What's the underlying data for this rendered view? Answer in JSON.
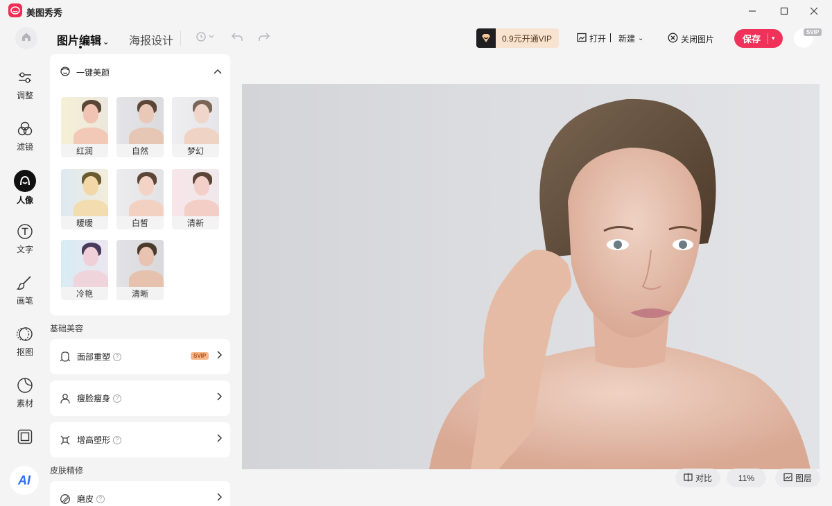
{
  "app": {
    "name": "美图秀秀",
    "brand_color": "#f02e55"
  },
  "header": {
    "tabs": [
      {
        "label": "图片编辑",
        "active": true
      },
      {
        "label": "海报设计",
        "active": false
      }
    ],
    "vip_label": "0.9元开通VIP",
    "open_label": "打开",
    "new_label": "新建",
    "close_label": "关闭图片",
    "save_label": "保存",
    "user_badge": "SVIP"
  },
  "sidebar": {
    "items": [
      {
        "label": "调整",
        "icon": "sliders-icon"
      },
      {
        "label": "滤镜",
        "icon": "filter-icon"
      },
      {
        "label": "人像",
        "icon": "portrait-icon",
        "active": true
      },
      {
        "label": "文字",
        "icon": "text-icon"
      },
      {
        "label": "画笔",
        "icon": "brush-icon"
      },
      {
        "label": "抠图",
        "icon": "cutout-icon"
      },
      {
        "label": "素材",
        "icon": "sticker-icon"
      },
      {
        "label": "",
        "icon": "frame-icon"
      }
    ],
    "ai_label": "AI"
  },
  "panel": {
    "one_click": {
      "title": "一键美颜",
      "presets": [
        "红润",
        "自然",
        "梦幻",
        "暖暖",
        "白皙",
        "清新",
        "冷艳",
        "清晰"
      ]
    },
    "basic": {
      "title": "基础美容",
      "items": [
        {
          "label": "面部重塑",
          "badge": "SVIP"
        },
        {
          "label": "瘦脸瘦身"
        },
        {
          "label": "增高塑形"
        }
      ]
    },
    "skin": {
      "title": "皮肤精修",
      "items": [
        {
          "label": "磨皮"
        }
      ]
    }
  },
  "bottom": {
    "compare_label": "对比",
    "zoom": "11%",
    "layers_label": "图层"
  }
}
